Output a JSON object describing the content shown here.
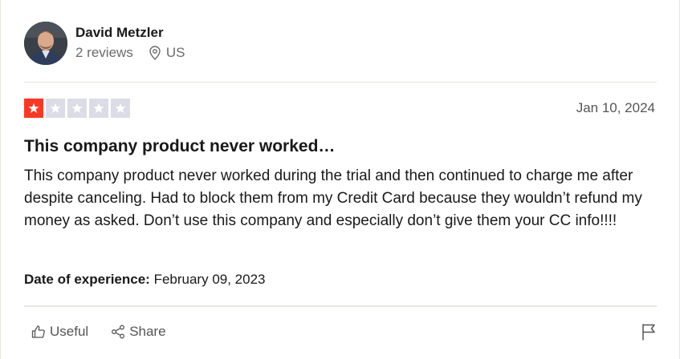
{
  "reviewer": {
    "name": "David Metzler",
    "review_count": "2 reviews",
    "country": "US"
  },
  "review": {
    "rating": 1,
    "max_rating": 5,
    "date": "Jan 10, 2024",
    "title": "This company product never worked…",
    "body": "This company product never worked during the trial and then continued to charge me after despite canceling. Had to block them from my Credit Card because they wouldn’t refund my money as asked. Don’t use this company and especially don’t give them your CC info!!!!",
    "experience_label": "Date of experience:",
    "experience_date": " February 09, 2023"
  },
  "actions": {
    "useful_label": "Useful",
    "share_label": "Share"
  },
  "colors": {
    "star_filled": "#ff3722",
    "star_empty": "#dcdce6"
  },
  "icons": [
    "location-pin-icon",
    "star-icon",
    "thumbs-up-icon",
    "share-icon",
    "flag-icon"
  ]
}
